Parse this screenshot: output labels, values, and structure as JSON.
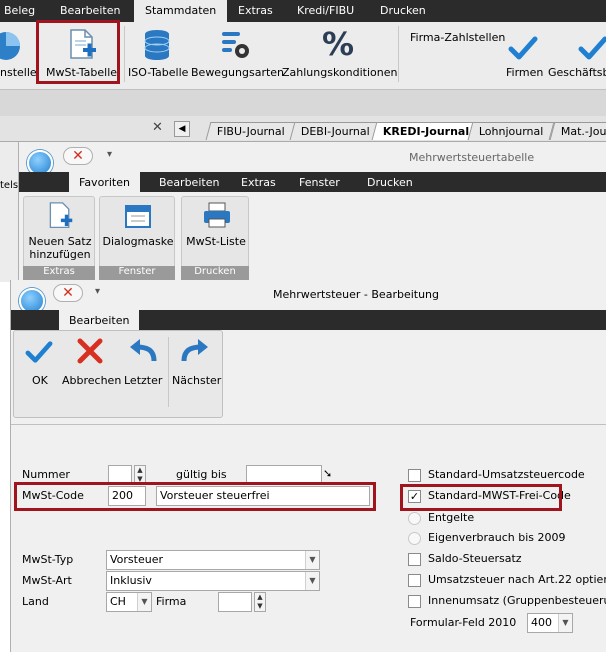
{
  "colors": {
    "accent": "#1f7fd0",
    "highlight": "#a0141e"
  },
  "top_menu": {
    "items": [
      "Beleg",
      "Bearbeiten",
      "Stammdaten",
      "Extras",
      "Kredi/FIBU",
      "Drucken"
    ]
  },
  "ribbon": {
    "items": [
      {
        "label": "nstelle",
        "icon": "pie-chart-icon"
      },
      {
        "label": "MwSt-Tabelle",
        "icon": "add-document-icon"
      },
      {
        "label": "ISO-Tabelle",
        "icon": "database-icon"
      },
      {
        "label": "Bewegungsarten",
        "icon": "settings-icon"
      },
      {
        "label": "Zahlungskonditionen",
        "icon": "percent-icon"
      },
      {
        "label": "Firmen",
        "icon": "checkmark-icon"
      },
      {
        "label": "Geschäftsbe",
        "icon": "checkmark-icon"
      }
    ],
    "group_title": "Firma-Zahlstellen"
  },
  "journal_tabs": {
    "close": "✕",
    "items": [
      "FIBU-Journal",
      "DEBI-Journal",
      "KREDI-Journal",
      "Lohnjournal",
      "Mat.-Jou"
    ]
  },
  "side_text": "tels",
  "window1": {
    "title": "Mehrwertsteuertabelle",
    "tabs": [
      "Favoriten",
      "Bearbeiten",
      "Extras",
      "Fenster",
      "Drucken"
    ],
    "buttons": [
      {
        "label": "Neuen Satz hinzufügen",
        "icon": "add-document-icon"
      },
      {
        "label": "Dialogmaske",
        "icon": "calendar-icon"
      },
      {
        "label": "MwSt-Liste",
        "icon": "printer-icon"
      }
    ],
    "groups": [
      "Extras",
      "Fenster",
      "Drucken"
    ]
  },
  "window2": {
    "title": "Mehrwertsteuer - Bearbeitung",
    "tab": "Bearbeiten",
    "buttons": [
      {
        "label": "OK",
        "icon": "checkmark-icon"
      },
      {
        "label": "Abbrechen",
        "icon": "cancel-icon"
      },
      {
        "label": "Letzter",
        "icon": "back-arrow-icon"
      },
      {
        "label": "Nächster",
        "icon": "forward-arrow-icon"
      }
    ]
  },
  "form": {
    "nummer_label": "Nummer",
    "nummer_value": "",
    "gueltig_label": "gültig bis",
    "gueltig_value": "",
    "mwst_code_label": "MwSt-Code",
    "mwst_code_value": "200",
    "mwst_code_desc": "Vorsteuer steuerfrei",
    "mwst_typ_label": "MwSt-Typ",
    "mwst_typ_value": "Vorsteuer",
    "mwst_art_label": "MwSt-Art",
    "mwst_art_value": "Inklusiv",
    "land_label": "Land",
    "land_value": "CH",
    "firma_label": "Firma",
    "firma_value": ""
  },
  "options": {
    "standard_umsatz": {
      "label": "Standard-Umsatzsteuercode",
      "checked": false
    },
    "standard_frei": {
      "label": "Standard-MWST-Frei-Code",
      "checked": true
    },
    "entgelte": {
      "label": "Entgelte"
    },
    "eigenverbrauch": {
      "label": "Eigenverbrauch bis 2009"
    },
    "saldo": {
      "label": "Saldo-Steuersatz",
      "checked": false
    },
    "art22": {
      "label": "Umsatzsteuer nach Art.22 optiert",
      "checked": false
    },
    "innenumsatz": {
      "label": "Innenumsatz (Gruppenbesteuerung)",
      "checked": false
    },
    "formular_label": "Formular-Feld 2010",
    "formular_value": "400"
  },
  "glyphs": {
    "check": "✓",
    "spin_up": "▲",
    "spin_down": "▼",
    "dropdown": "▼",
    "pin": "▾",
    "arrow_down": "➘"
  }
}
